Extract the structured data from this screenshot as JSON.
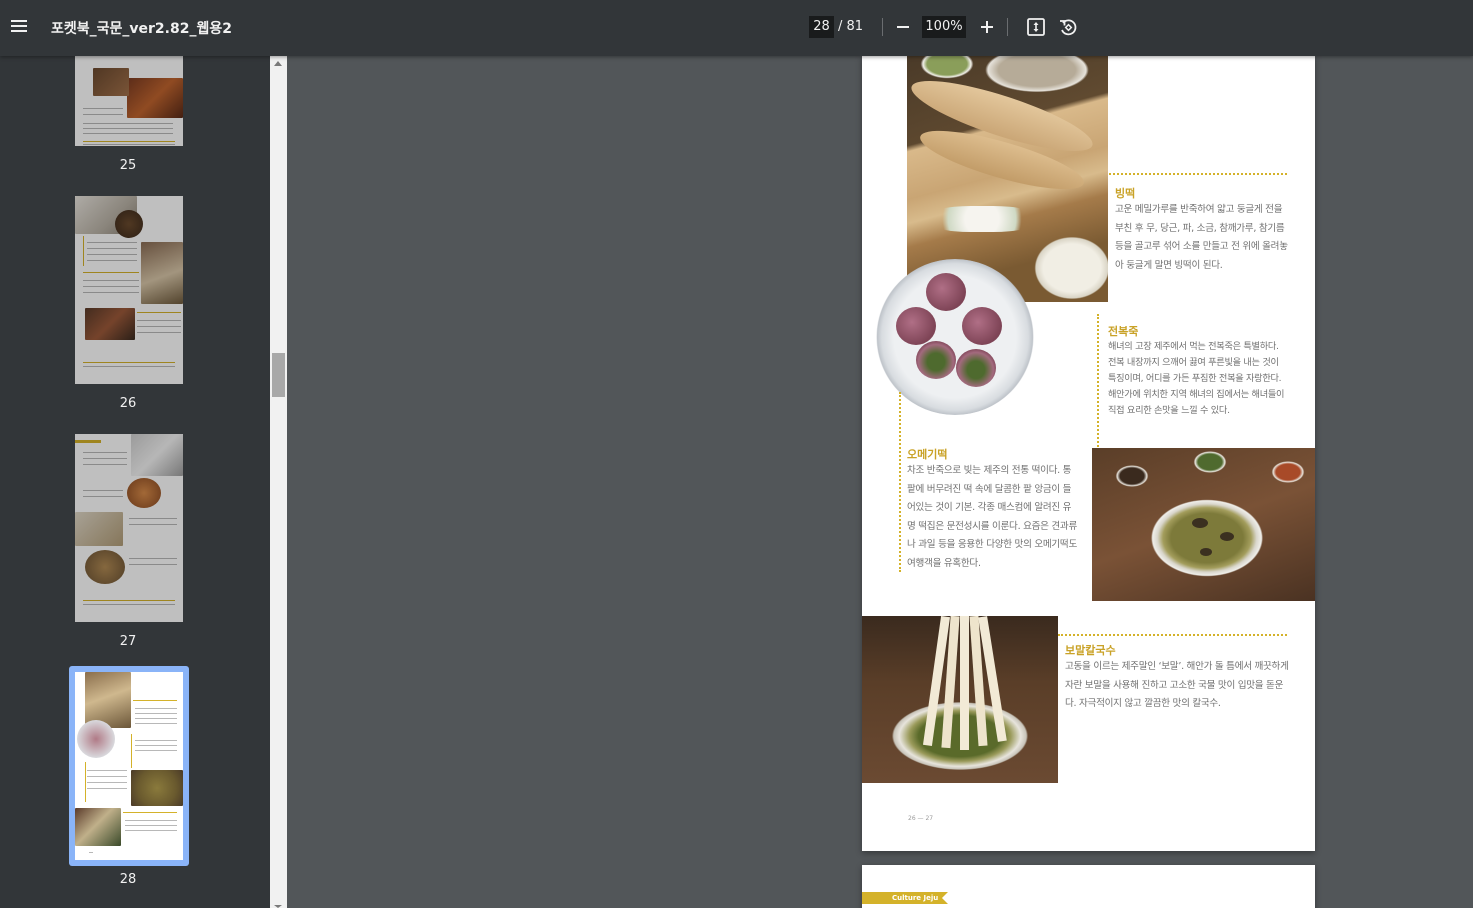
{
  "toolbar": {
    "title": "포켓북_국문_ver2.82_웹용2",
    "current_page": "28",
    "total_pages": "/ 81",
    "zoom": "100%",
    "menu_icon": "hamburger-menu-icon",
    "zoom_out_icon": "minus-icon",
    "zoom_in_icon": "plus-icon",
    "fit_icon": "fit-to-page-icon",
    "rotate_icon": "rotate-icon"
  },
  "sidebar": {
    "thumbnails": [
      {
        "page": "25",
        "selected": false
      },
      {
        "page": "26",
        "selected": false
      },
      {
        "page": "27",
        "selected": false
      },
      {
        "page": "28",
        "selected": true
      }
    ],
    "selection_color": "#8ab4f8"
  },
  "page": {
    "sections": {
      "bingtteok": {
        "title": "빙떡",
        "body": "고운 메밀가루를 반죽하여 얇고 둥글게 전을 부친 후 무, 당근, 파, 소금, 참깨가루, 참기름 등을 골고루 섞어 소를 만들고 전 위에 올려놓아 둥글게 말면 빙떡이 된다."
      },
      "jeonbokjuk": {
        "title": "전복죽",
        "body": "해녀의 고장 제주에서 먹는 전복죽은 특별하다. 전복 내장까지 으깨어 끓여 푸른빛을 내는 것이 특징이며, 어디를 가든 푸짐한 전복을 자랑한다. 해안가에 위치한 지역 해녀의 집에서는 해녀들이 직접 요리한 손맛을 느낄 수 있다."
      },
      "omegitteok": {
        "title": "오메기떡",
        "body": "차조 반죽으로 빚는 제주의 전통 떡이다. 통팥에 버무려진 떡 속에 달콤한 팥 앙금이 들어있는 것이 기본. 각종 매스컴에 알려진 유명 떡집은 문전성시를 이룬다. 요즘은 견과류나 과일 등을 응용한 다양한 맛의 오메기떡도 여행객을 유혹한다."
      },
      "bomalkalguksu": {
        "title": "보말칼국수",
        "body": "고동을 이르는 제주말인 ‘보말’. 해안가 돌 틈에서 깨끗하게 자란 보말을 사용해 진하고 고소한 국물 맛이 입맛을 돋운다. 자극적이지 않고 깔끔한 맛의 칼국수."
      }
    },
    "folio": "26 — 27",
    "accent_color": "#c9a227"
  },
  "next_page": {
    "tag": "Culture Jeju"
  }
}
